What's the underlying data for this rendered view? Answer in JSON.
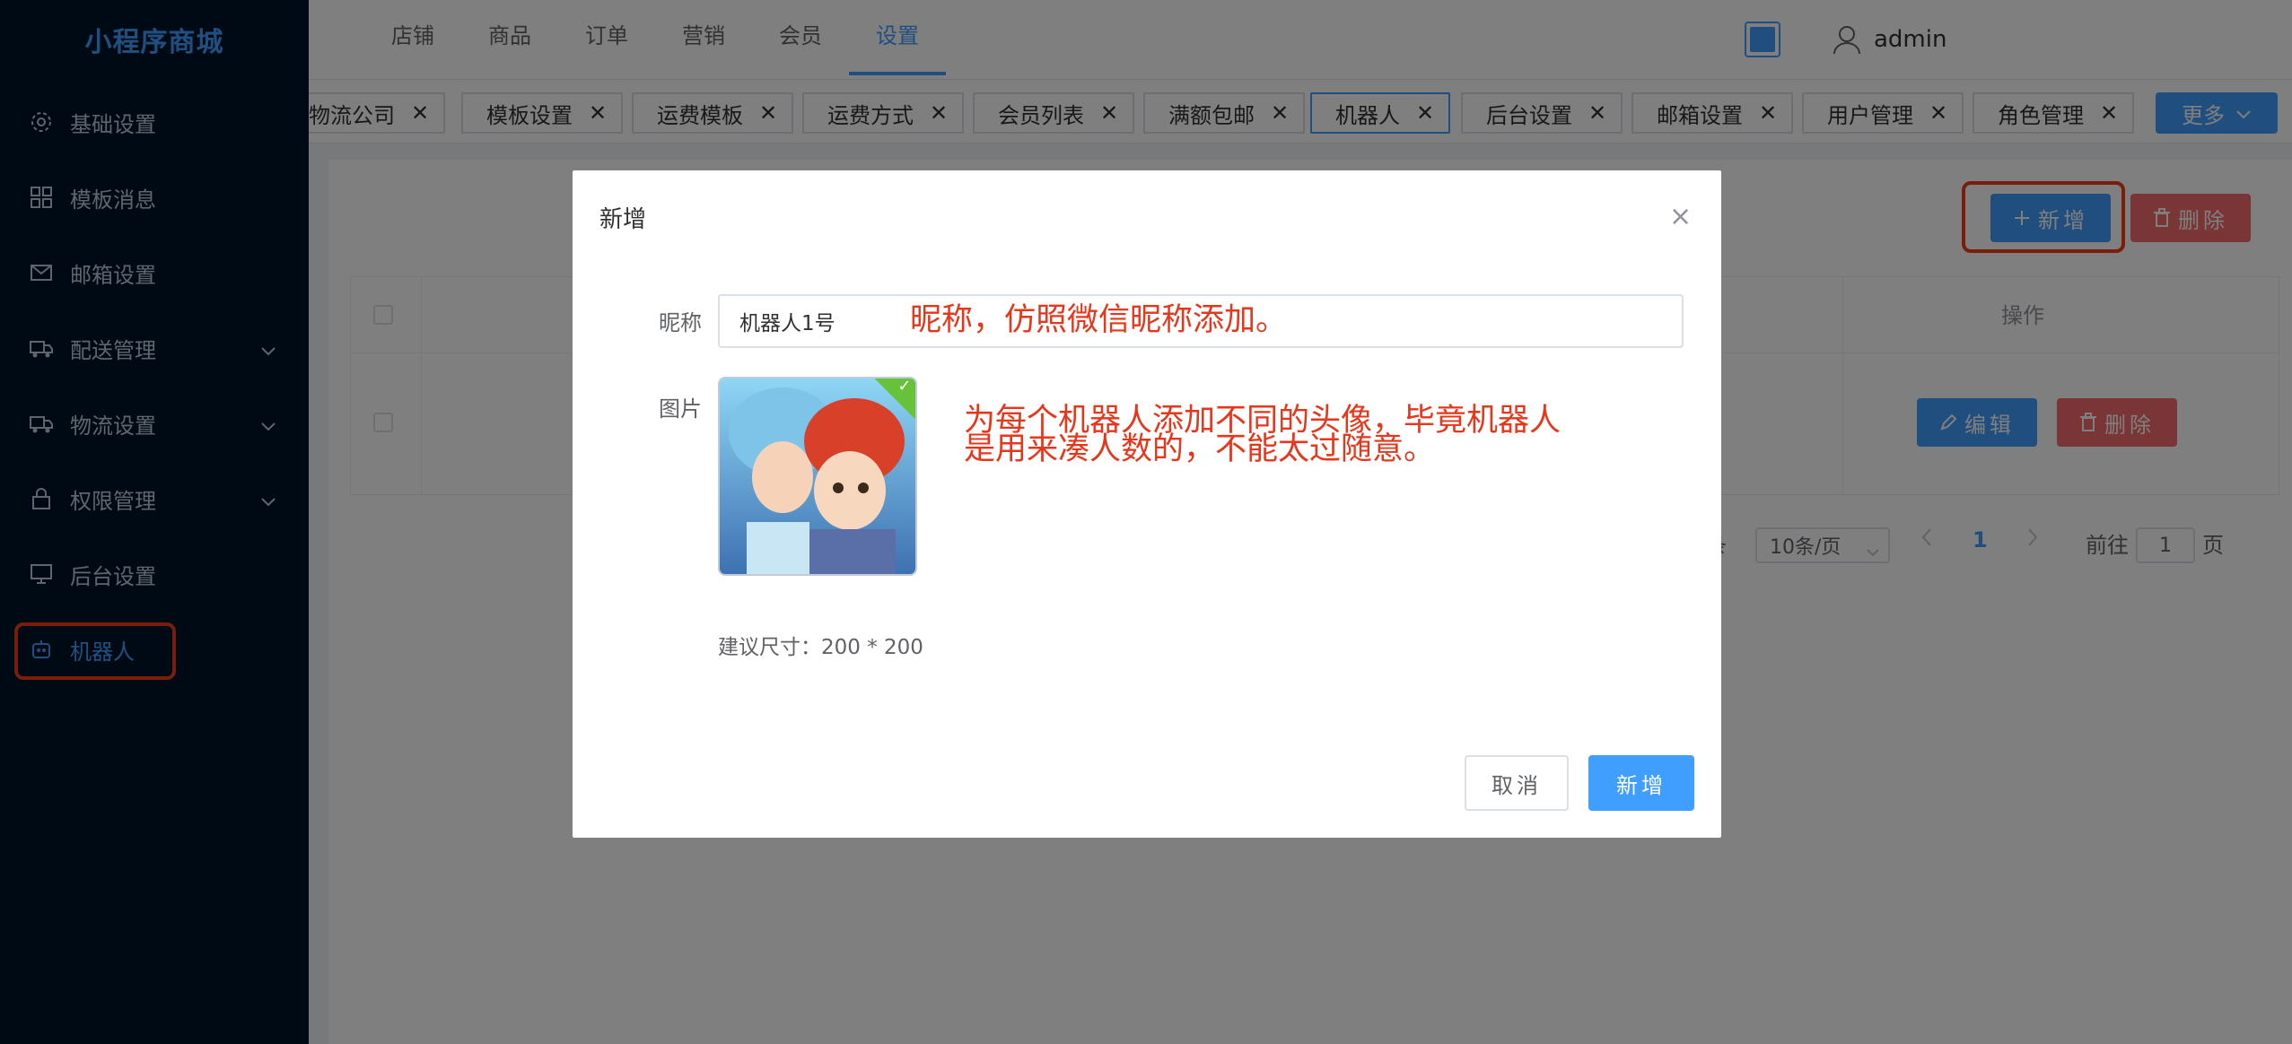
{
  "app": {
    "logo": "小程序商城"
  },
  "sidebar": {
    "items": [
      {
        "label": "基础设置",
        "icon": "gear-icon"
      },
      {
        "label": "模板消息",
        "icon": "grid-icon"
      },
      {
        "label": "邮箱设置",
        "icon": "mail-icon"
      },
      {
        "label": "配送管理",
        "icon": "delivery-icon"
      },
      {
        "label": "物流设置",
        "icon": "truck-icon"
      },
      {
        "label": "权限管理",
        "icon": "lock-icon"
      },
      {
        "label": "后台设置",
        "icon": "monitor-icon"
      },
      {
        "label": "机器人",
        "icon": "robot-icon"
      }
    ],
    "active": "机器人"
  },
  "topnav": {
    "items": [
      "店铺",
      "商品",
      "订单",
      "营销",
      "会员",
      "设置"
    ],
    "active": "设置",
    "user": "admin"
  },
  "tags": {
    "items": [
      "物流公司",
      "模板设置",
      "运费模板",
      "运费方式",
      "会员列表",
      "满额包邮",
      "机器人",
      "后台设置",
      "邮箱设置",
      "用户管理",
      "角色管理"
    ],
    "active": "机器人",
    "more": "更多"
  },
  "toolbar": {
    "add": "新增",
    "delete": "删除"
  },
  "table": {
    "ops_header": "操作",
    "edit": "编辑",
    "delete": "删除"
  },
  "pager": {
    "total_suffix": "条",
    "page_size": "10条/页",
    "current": "1",
    "goto_prefix": "前往",
    "goto_value": "1",
    "goto_suffix": "页"
  },
  "dialog": {
    "title": "新增",
    "close": "×",
    "nick_label": "昵称",
    "nick_value": "机器人1号",
    "image_label": "图片",
    "hint": "建议尺寸：200 * 200",
    "cancel": "取消",
    "confirm": "新增"
  },
  "annotations": {
    "nick": "昵称，仿照微信昵称添加。",
    "avatar_line1": "为每个机器人添加不同的头像，毕竟机器人",
    "avatar_line2": "是用来凑人数的，不能太过随意。"
  },
  "colors": {
    "primary": "#409eff",
    "danger": "#f56c6c",
    "sidebar": "#001529",
    "annotation": "#e8361b",
    "success": "#67c23a"
  }
}
